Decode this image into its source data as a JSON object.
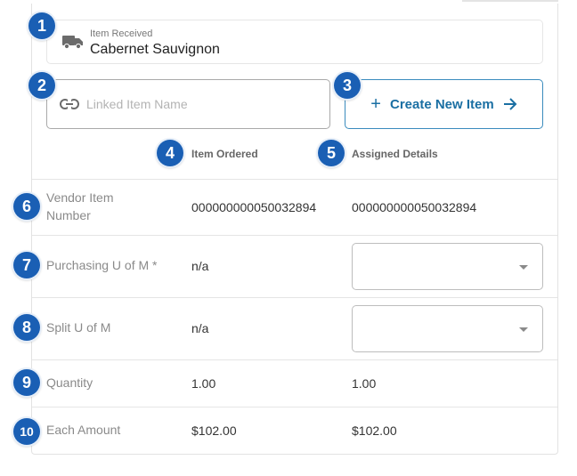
{
  "received": {
    "label": "Item Received",
    "value": "Cabernet Sauvignon",
    "icon": "truck-icon"
  },
  "linked_item": {
    "placeholder": "Linked Item Name",
    "icon": "link-icon"
  },
  "create_button": {
    "label": "Create New Item",
    "icon_left": "plus-icon",
    "icon_right": "arrow-right-icon",
    "color": "#1a6fa3"
  },
  "columns": {
    "ordered": "Item Ordered",
    "assigned": "Assigned Details"
  },
  "rows": {
    "vendor_item_number": {
      "label": "Vendor Item Number",
      "ordered": "000000000050032894",
      "assigned": "000000000050032894"
    },
    "purchasing_uom": {
      "label": "Purchasing U of M *",
      "ordered": "n/a",
      "assigned": ""
    },
    "split_uom": {
      "label": "Split U of M",
      "ordered": "n/a",
      "assigned": ""
    },
    "quantity": {
      "label": "Quantity",
      "ordered": "1.00",
      "assigned": "1.00"
    },
    "each_amount": {
      "label": "Each Amount",
      "ordered": "$102.00",
      "assigned": "$102.00"
    }
  },
  "badges": [
    "1",
    "2",
    "3",
    "4",
    "5",
    "6",
    "7",
    "8",
    "9",
    "10"
  ],
  "badge_color": "#1a5fb4"
}
